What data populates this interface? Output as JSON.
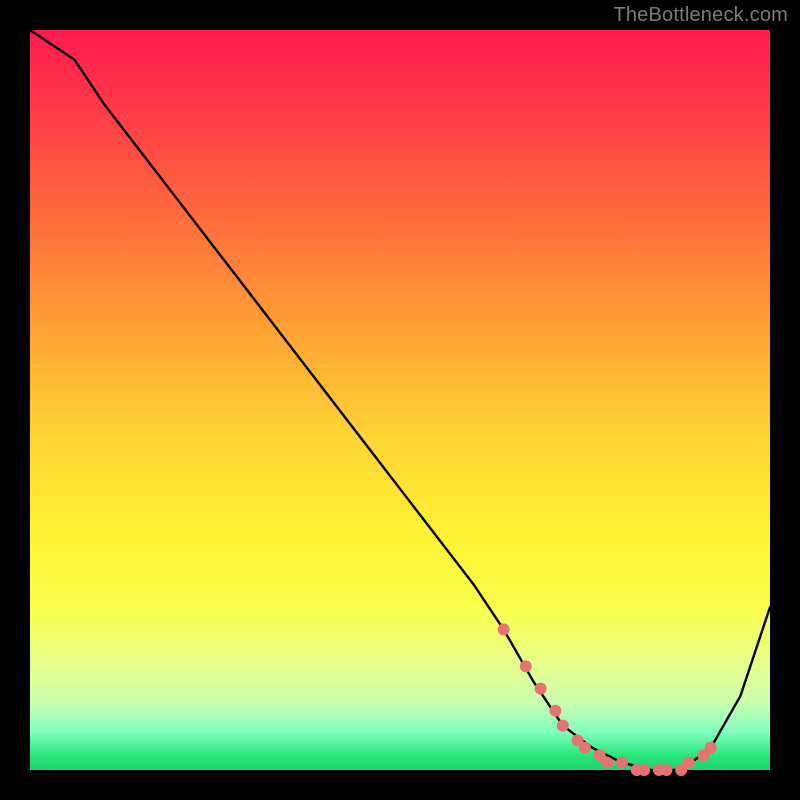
{
  "attribution": "TheBottleneck.com",
  "chart_data": {
    "type": "line",
    "title": "",
    "xlabel": "",
    "ylabel": "",
    "xlim": [
      0,
      100
    ],
    "ylim": [
      0,
      100
    ],
    "gradient_stops": [
      {
        "pos": 0,
        "color": "#ff1a4d"
      },
      {
        "pos": 10,
        "color": "#ff3848"
      },
      {
        "pos": 25,
        "color": "#ff6a3c"
      },
      {
        "pos": 40,
        "color": "#ffa033"
      },
      {
        "pos": 55,
        "color": "#ffd433"
      },
      {
        "pos": 68,
        "color": "#fff233"
      },
      {
        "pos": 78,
        "color": "#f9ff4a"
      },
      {
        "pos": 85,
        "color": "#eaff86"
      },
      {
        "pos": 91,
        "color": "#c9ffb0"
      },
      {
        "pos": 95,
        "color": "#7dffc0"
      },
      {
        "pos": 98,
        "color": "#27e77a"
      },
      {
        "pos": 100,
        "color": "#1fd36c"
      }
    ],
    "series": [
      {
        "name": "bottleneck-curve",
        "x": [
          0,
          6,
          10,
          20,
          30,
          40,
          50,
          60,
          64,
          68,
          72,
          76,
          80,
          84,
          88,
          92,
          96,
          100
        ],
        "values": [
          100,
          96,
          90,
          77,
          64,
          51,
          38,
          25,
          19,
          12,
          6,
          3,
          1,
          0,
          0,
          3,
          10,
          22
        ]
      }
    ],
    "markers": {
      "name": "highlight-dots",
      "color": "#e87272",
      "x": [
        64,
        67,
        69,
        71,
        72,
        74,
        75,
        77,
        78,
        80,
        82,
        83,
        85,
        86,
        88,
        89,
        91,
        92
      ],
      "values": [
        19,
        14,
        11,
        8,
        6,
        4,
        3,
        2,
        1,
        1,
        0,
        0,
        0,
        0,
        0,
        1,
        2,
        3
      ]
    }
  }
}
